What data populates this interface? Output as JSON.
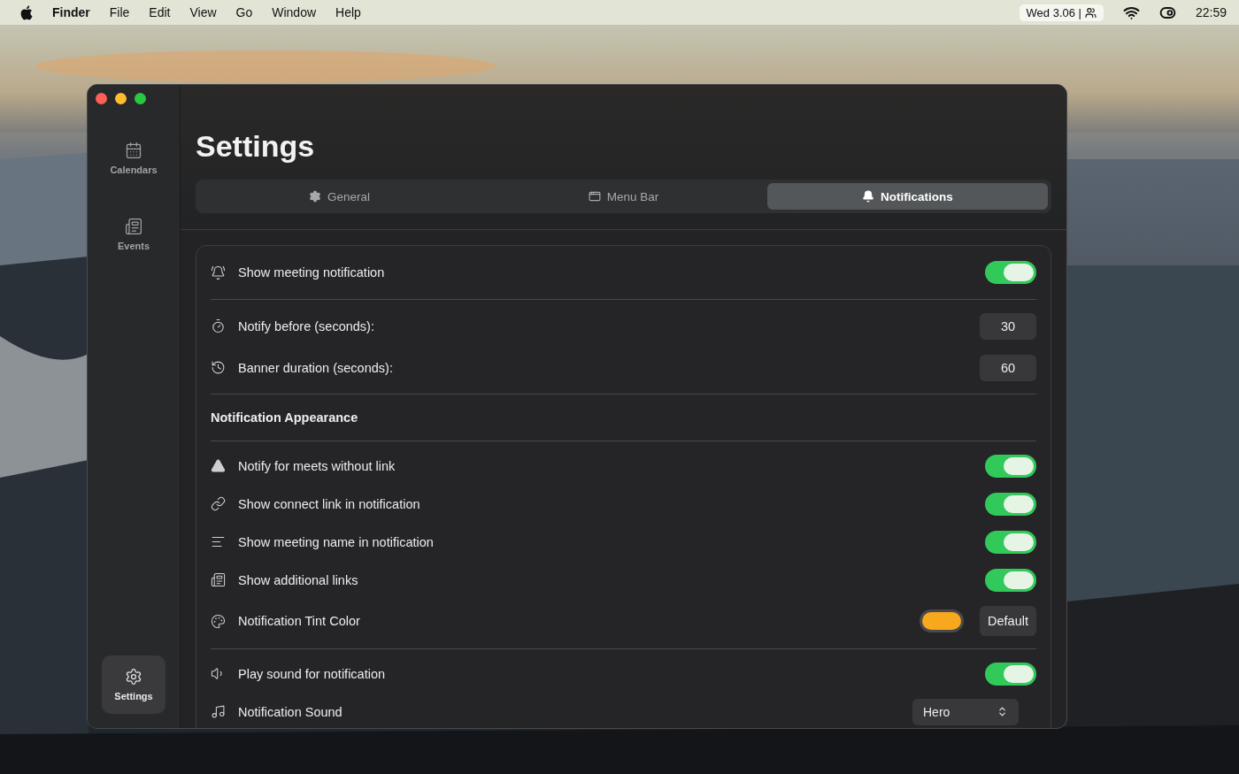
{
  "menu_bar": {
    "app": "Finder",
    "menus": [
      "File",
      "Edit",
      "View",
      "Go",
      "Window",
      "Help"
    ],
    "date": "Wed 3.06 |",
    "time": "22:59"
  },
  "sidebar": [
    {
      "label": "Calendars",
      "selected": false
    },
    {
      "label": "Events",
      "selected": false
    }
  ],
  "sidebar_footer": {
    "label": "Settings",
    "selected": true
  },
  "title": "Settings",
  "tabs": [
    {
      "label": "General",
      "selected": false
    },
    {
      "label": "Menu Bar",
      "selected": false
    },
    {
      "label": "Notifications",
      "selected": true
    }
  ],
  "groups": [
    [
      {
        "kind": "toggle",
        "label": "Show meeting notification",
        "on": true
      }
    ],
    [
      {
        "kind": "number",
        "label": "Notify before (seconds):",
        "value": "30"
      },
      {
        "kind": "number",
        "label": "Banner duration (seconds):",
        "value": "60"
      }
    ],
    [
      {
        "kind": "heading",
        "label": "Notification Appearance"
      }
    ],
    [
      {
        "kind": "toggle",
        "label": "Notify for meets without link",
        "on": true
      },
      {
        "kind": "toggle",
        "label": "Show connect link in notification",
        "on": true
      },
      {
        "kind": "toggle",
        "label": "Show meeting name in notification",
        "on": true
      },
      {
        "kind": "toggle",
        "label": "Show additional links",
        "on": true
      },
      {
        "kind": "color",
        "label": "Notification Tint Color",
        "color": "#f8a81c",
        "button": "Default"
      }
    ],
    [
      {
        "kind": "toggle",
        "label": "Play sound for notification",
        "on": true
      },
      {
        "kind": "select",
        "label": "Notification Sound",
        "value": "Hero"
      }
    ]
  ]
}
